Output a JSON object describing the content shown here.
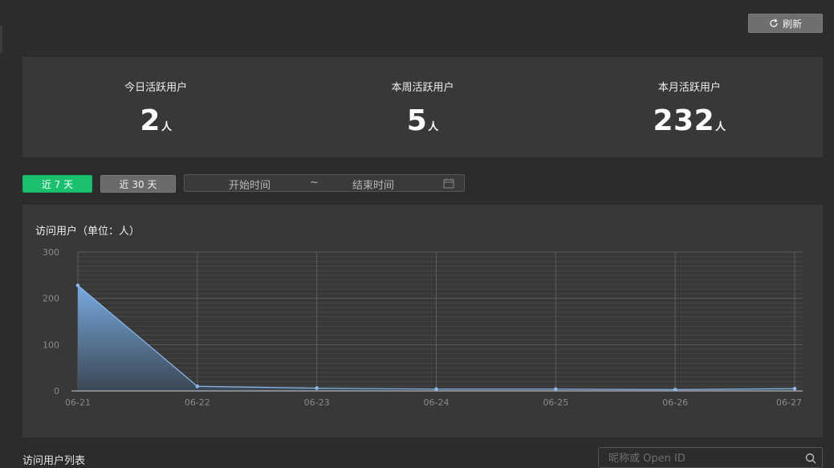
{
  "header": {
    "refresh_label": "刷新"
  },
  "stats": [
    {
      "label": "今日活跃用户",
      "value": "2",
      "unit": "人"
    },
    {
      "label": "本周活跃用户",
      "value": "5",
      "unit": "人"
    },
    {
      "label": "本月活跃用户",
      "value": "232",
      "unit": "人"
    }
  ],
  "filters": {
    "last7_label": "近 7 天",
    "last30_label": "近 30 天",
    "start_placeholder": "开始时间",
    "separator": "~",
    "end_placeholder": "结束时间",
    "active": "近 7 天"
  },
  "chart": {
    "title": "访问用户（单位：人）"
  },
  "chart_data": {
    "type": "area",
    "x": [
      "06-21",
      "06-22",
      "06-23",
      "06-24",
      "06-25",
      "06-26",
      "06-27"
    ],
    "series": [
      {
        "values": [
          228,
          10,
          6,
          4,
          4,
          3,
          5
        ]
      }
    ],
    "ylim": [
      0,
      300
    ],
    "yticks": [
      0,
      100,
      200,
      300
    ],
    "grid": true,
    "colors": {
      "line": "#8ab8e8",
      "fill_top": "#7bb2ea",
      "fill_bottom": "#3c4a5a",
      "grid": "#5d5d5d",
      "axis": "#cfcfcf",
      "tick_text": "#8a8a8a"
    }
  },
  "list": {
    "title": "访问用户列表",
    "search_placeholder": "昵称或 Open ID"
  },
  "icons": {
    "refresh": "refresh-icon",
    "calendar": "calendar-icon",
    "search": "search-icon"
  }
}
